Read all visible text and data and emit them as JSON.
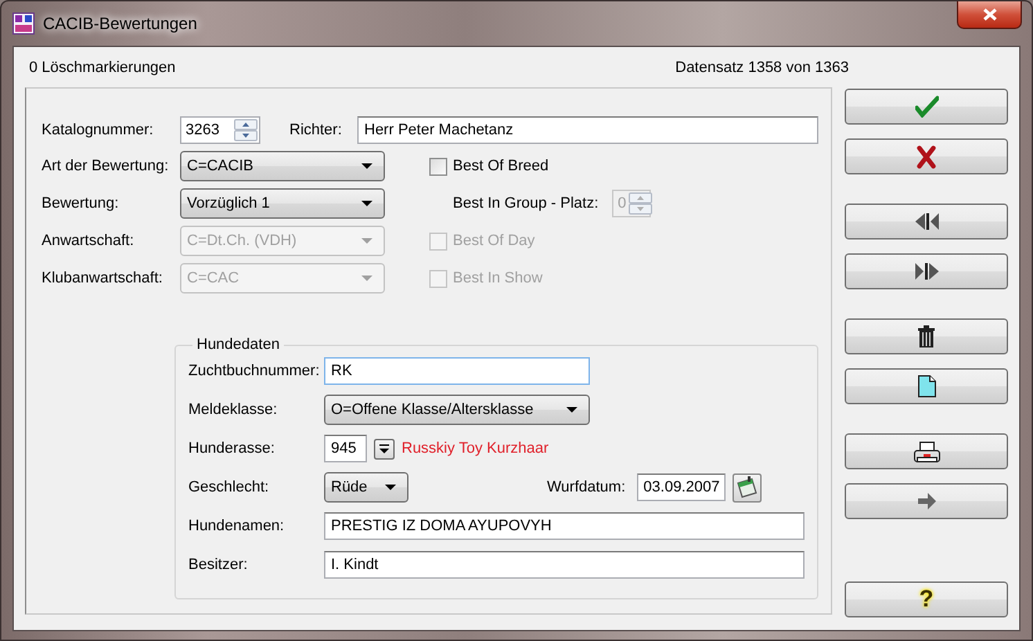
{
  "window": {
    "title": "CACIB-Bewertungen"
  },
  "header": {
    "deletion_marks": "0 Löschmarkierungen",
    "record": "Datensatz 1358 von 1363"
  },
  "evaluation": {
    "catalog_number": {
      "label": "Katalognummer:",
      "value": "3263"
    },
    "judge": {
      "label": "Richter:",
      "value": "Herr Peter Machetanz",
      "focused": false
    },
    "combos": [
      {
        "label": "Art der Bewertung:",
        "value": "C=CACIB",
        "disabled": false
      },
      {
        "label": "Bewertung:",
        "value": "Vorzüglich 1",
        "disabled": false
      },
      {
        "label": "Anwartschaft:",
        "value": "C=Dt.Ch. (VDH)",
        "disabled": true
      },
      {
        "label": "Klubanwartschaft:",
        "value": "C=CAC",
        "disabled": true
      }
    ],
    "side": [
      {
        "kind": "checkbox",
        "label": "Best Of Breed",
        "checked": false,
        "disabled": false
      },
      {
        "kind": "spinner",
        "label": "Best In Group - Platz:",
        "value": "0",
        "disabled": true
      },
      {
        "kind": "checkbox",
        "label": "Best Of Day",
        "checked": false,
        "disabled": true
      },
      {
        "kind": "checkbox",
        "label": "Best In Show",
        "checked": false,
        "disabled": true
      }
    ]
  },
  "dog_data": {
    "title": "Hundedaten",
    "breeding_number": {
      "label": "Zuchtbuchnummer:",
      "value": "RK",
      "focused": true
    },
    "class": {
      "label": "Meldeklasse:",
      "value": "O=Offene Klasse/Altersklasse"
    },
    "breed": {
      "label": "Hunderasse:",
      "code": "945",
      "name": "Russkiy Toy Kurzhaar",
      "color": "#e0202a"
    },
    "sex": {
      "label": "Geschlecht:",
      "value": "Rüde"
    },
    "birth_date": {
      "label": "Wurfdatum:",
      "value": "03.09.2007"
    },
    "name": {
      "label": "Hundenamen:",
      "value": "PRESTIG IZ DOMA AYUPOVYH",
      "focused": false
    },
    "owner": {
      "label": "Besitzer:",
      "value": "I. Kindt",
      "focused": false
    }
  },
  "button_groups": [
    [
      {
        "kind": "save"
      },
      {
        "kind": "cancel"
      }
    ],
    [
      {
        "kind": "first"
      },
      {
        "kind": "last"
      }
    ],
    [
      {
        "kind": "delete"
      },
      {
        "kind": "new"
      }
    ],
    [
      {
        "kind": "print"
      },
      {
        "kind": "exit"
      }
    ],
    [
      {
        "kind": "help",
        "label": "?"
      }
    ]
  ]
}
